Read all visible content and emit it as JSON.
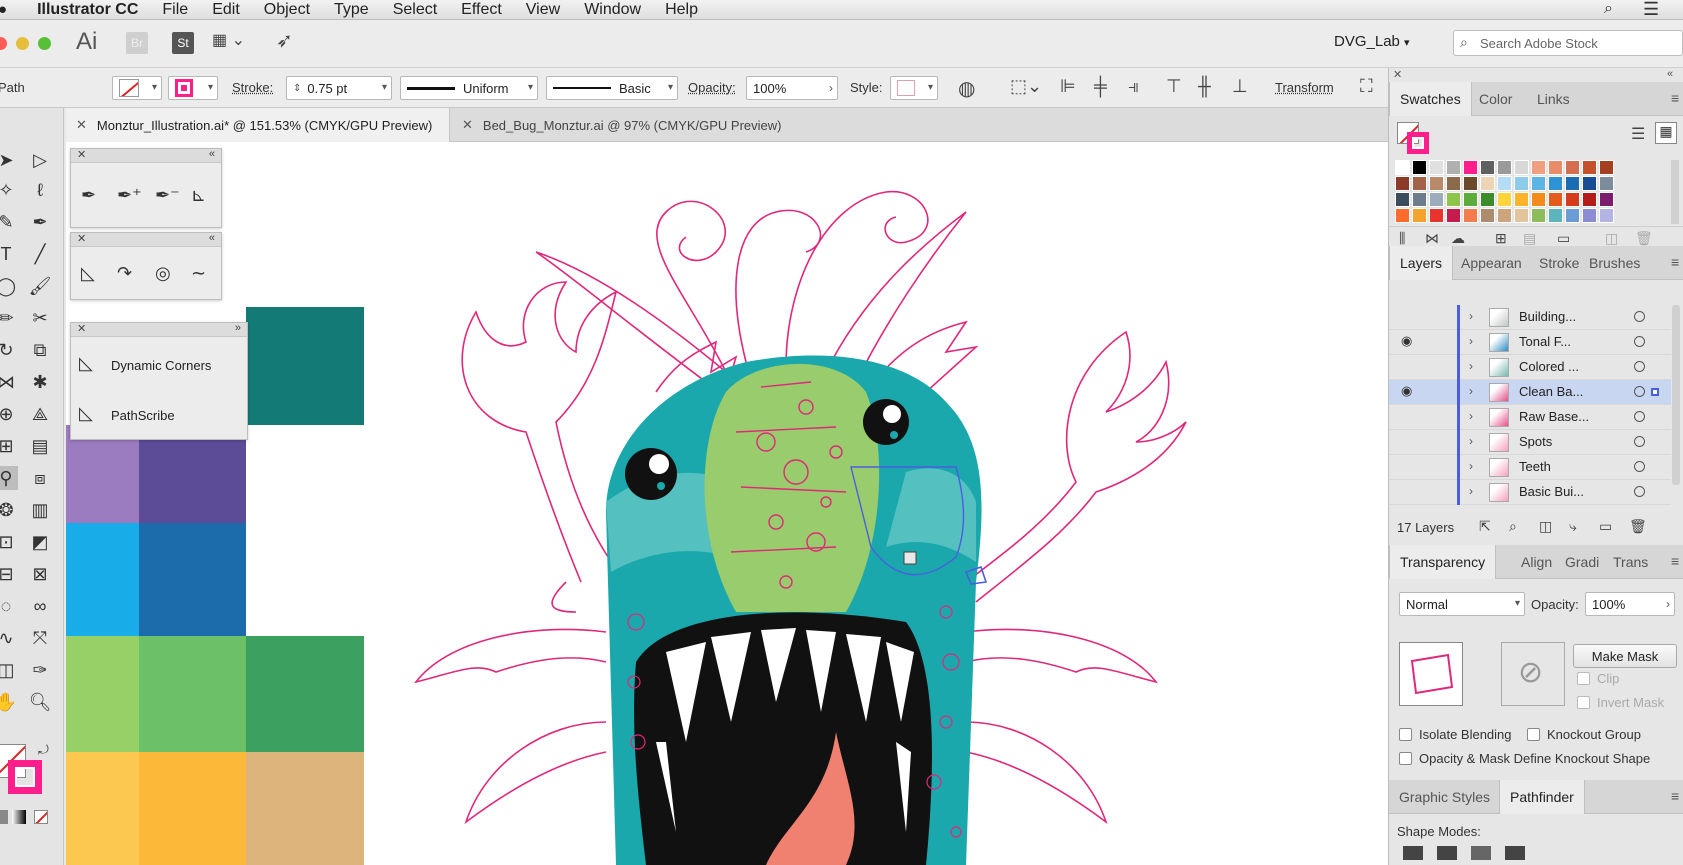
{
  "menubar": {
    "app_name": "Illustrator CC",
    "items": [
      "File",
      "Edit",
      "Object",
      "Type",
      "Select",
      "Effect",
      "View",
      "Window",
      "Help"
    ]
  },
  "appbar": {
    "ai_logo": "Ai",
    "br_logo": "Br",
    "st_logo": "St",
    "workspace": "DVG_Lab",
    "search_placeholder": "Search Adobe Stock"
  },
  "control_bar": {
    "selection_label": "Path",
    "stroke_label": "Stroke:",
    "stroke_weight": "0.75 pt",
    "stroke_profile": "Uniform",
    "brush_def": "Basic",
    "opacity_label": "Opacity:",
    "opacity_value": "100%",
    "style_label": "Style:",
    "transform_label": "Transform"
  },
  "doc_tabs": [
    {
      "title": "Monztur_Illustration.ai* @ 151.53% (CMYK/GPU Preview)",
      "active": true
    },
    {
      "title": "Bed_Bug_Monztur.ai @ 97% (CMYK/GPU Preview)",
      "active": false
    }
  ],
  "floating_panels": {
    "plugin_items": [
      "Dynamic Corners",
      "PathScribe"
    ]
  },
  "swatches_panel": {
    "tabs": [
      "Swatches",
      "Color",
      "Links"
    ],
    "colors_row1": [
      "#ffffff",
      "#000000",
      "#e0e0e0",
      "#b0b0b0",
      "#ff1e8c",
      "#606060",
      "#9a9a9a",
      "#d8d8d8",
      "#f0a080",
      "#e88c6a",
      "#d46e4e",
      "#c4502c",
      "#a44020"
    ],
    "colors_row2": [
      "#8c3a2a",
      "#a4624a",
      "#b88a6a",
      "#8a6a4a",
      "#6a4a2a",
      "#ecd4b4",
      "#b4dcf4",
      "#8ccce8",
      "#5cb4e4",
      "#2c94d4",
      "#1c6cb4",
      "#184c94",
      "#7c8c9c"
    ],
    "colors_row3": [
      "#3c4c5c",
      "#6c7c8c",
      "#9cacbc",
      "#8cc44c",
      "#5cac3c",
      "#3c8c2c",
      "#fcd43c",
      "#fcb42c",
      "#f48c1c",
      "#e45c1c",
      "#d43c1c",
      "#b41c1c",
      "#7c1c6c"
    ],
    "colors_row4": [
      "#ff6c2c",
      "#f4a42c",
      "#e8342c",
      "#c41c4c",
      "#f47c4c",
      "#ac8c6c",
      "#cca47c",
      "#e4c49c",
      "#8cbc5c",
      "#5cb4bc",
      "#6c9cd4",
      "#8c8cd4",
      "#b4b4e4"
    ]
  },
  "layers_panel": {
    "tabs": [
      "Layers",
      "Appearan",
      "Stroke",
      "Brushes"
    ],
    "rows": [
      {
        "name": "Building...",
        "visible": false,
        "selected": false,
        "thumb": "#c0c8c8"
      },
      {
        "name": "Tonal F...",
        "visible": true,
        "selected": false,
        "thumb": "#2c8cc4"
      },
      {
        "name": "Colored ...",
        "visible": false,
        "selected": false,
        "thumb": "#78b8b0"
      },
      {
        "name": "Clean Ba...",
        "visible": true,
        "selected": true,
        "thumb": "#e0508c"
      },
      {
        "name": "Raw Base...",
        "visible": false,
        "selected": false,
        "thumb": "#e8508c"
      },
      {
        "name": "Spots",
        "visible": false,
        "selected": false,
        "thumb": "#f4a0c0"
      },
      {
        "name": "Teeth",
        "visible": false,
        "selected": false,
        "thumb": "#f4a0c0"
      },
      {
        "name": "Basic Bui...",
        "visible": false,
        "selected": false,
        "thumb": "#f4a0c0"
      }
    ],
    "count_label": "17 Layers"
  },
  "transparency_panel": {
    "tabs": [
      "Transparency",
      "Align",
      "Gradi",
      "Trans"
    ],
    "blend_mode": "Normal",
    "opacity_label": "Opacity:",
    "opacity_value": "100%",
    "make_mask": "Make Mask",
    "clip": "Clip",
    "invert_mask": "Invert Mask",
    "isolate_blending": "Isolate Blending",
    "knockout_group": "Knockout Group",
    "opacity_mask_define": "Opacity & Mask Define Knockout Shape"
  },
  "pathfinder_panel": {
    "tabs": [
      "Graphic Styles",
      "Pathfinder"
    ],
    "shape_modes_label": "Shape Modes:"
  },
  "colors": {
    "accent_magenta": "#e0287a",
    "monster_teal": "#1aa8ac",
    "monster_green": "#98cc6c",
    "selection_blue": "#4a5ee0"
  }
}
